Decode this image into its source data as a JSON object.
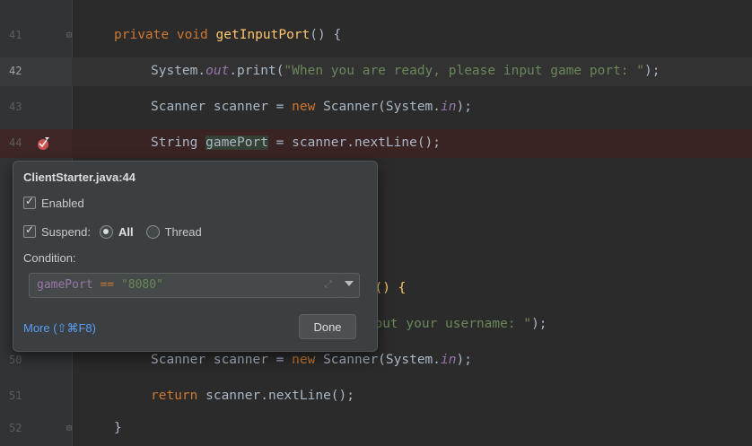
{
  "colors": {
    "editor_bg": "#2b2b2b",
    "keyword": "#cc7832",
    "function": "#ffc66d",
    "string": "#6a8759",
    "field": "#9876aa",
    "default": "#a9b7c6",
    "link": "#589df6"
  },
  "lines": [
    {
      "number": "41",
      "seg1": "private void ",
      "seg2": "getInputPort",
      "seg3": "() {"
    },
    {
      "number": "42",
      "seg1": "System.",
      "seg2": "out",
      "seg3": ".print(",
      "seg4": "\"When you are ready, please input game port: \"",
      "seg5": ");"
    },
    {
      "number": "43",
      "seg1": "Scanner scanner = ",
      "seg2": "new",
      "seg3": " Scanner(System.",
      "seg4": "in",
      "seg5": ");"
    },
    {
      "number": "44",
      "seg1": "String ",
      "seg2": "gamePort",
      "seg3": " = scanner.nextLine();"
    },
    {
      "number": "",
      "seg1": "me() {"
    },
    {
      "number": "",
      "seg1": "input your username: \"",
      "seg2": ");"
    },
    {
      "number": "50",
      "seg1": "Scanner scanner = ",
      "seg2": "new",
      "seg3": " Scanner(System.",
      "seg4": "in",
      "seg5": ");"
    },
    {
      "number": "51",
      "seg1": "return",
      "seg2": " scanner.nextLine();"
    },
    {
      "number": "52",
      "seg1": "}"
    }
  ],
  "breakpoint_popup": {
    "title": "ClientStarter.java:44",
    "enabled_label": "Enabled",
    "enabled_checked": true,
    "suspend_label": "Suspend:",
    "suspend_checked": true,
    "option_all": "All",
    "option_thread": "Thread",
    "selected_option": "All",
    "condition_label": "Condition:",
    "condition_var": "gamePort",
    "condition_op": " == ",
    "condition_value": "\"8080\"",
    "more_link": "More (⇧⌘F8)",
    "done_label": "Done"
  },
  "icons": {
    "breakpoint": "breakpoint-conditional-icon",
    "fold": "fold-marker-icon",
    "expand": "expand-field-icon",
    "dropdown": "chevron-down-icon"
  }
}
